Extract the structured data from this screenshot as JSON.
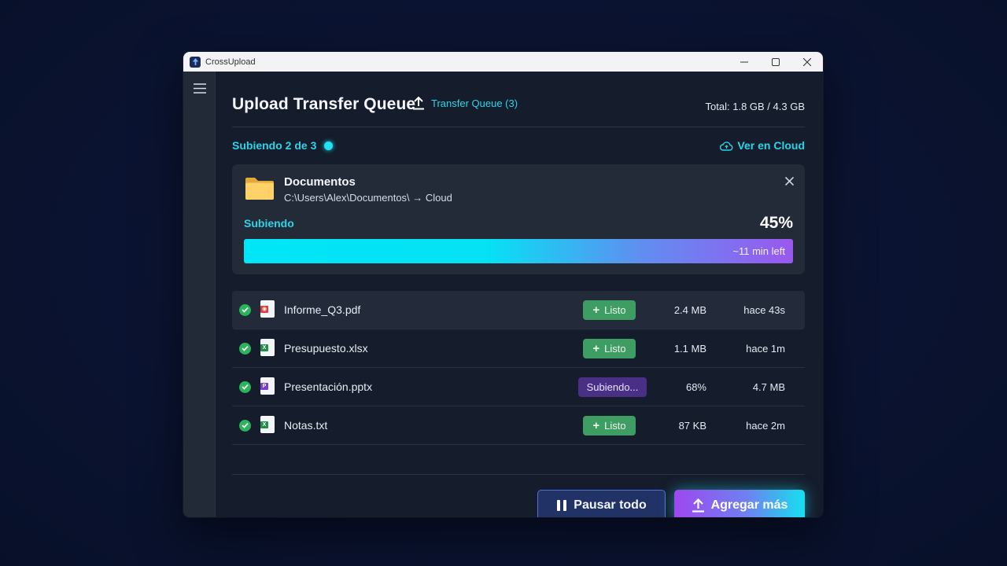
{
  "window": {
    "app_name": "CrossUpload"
  },
  "header": {
    "title": "Upload Transfer Queue",
    "queue_link": "Transfer Queue (3)",
    "total": "Total: 1.8 GB / 4.3 GB"
  },
  "status": {
    "text": "Subiendo 2 de 3",
    "cloud_link": "Ver en Cloud"
  },
  "current": {
    "name": "Documentos",
    "path": "C:\\Users\\Alex\\Documentos\\ → Cloud",
    "state": "Subiendo",
    "percent_label": "45%",
    "progress": 0.45,
    "eta": "~11 min left"
  },
  "files": [
    {
      "name": "Informe_Q3.pdf",
      "type": "pdf",
      "badge": "Listo",
      "badge_kind": "done",
      "col1": "2.4 MB",
      "col2": "hace 43s"
    },
    {
      "name": "Presupuesto.xlsx",
      "type": "xlsx",
      "badge": "Listo",
      "badge_kind": "done",
      "col1": "1.1 MB",
      "col2": "hace 1m"
    },
    {
      "name": "Presentación.pptx",
      "type": "pptx",
      "badge": "Subiendo...",
      "badge_kind": "uploading",
      "col1": "68%",
      "col2": "4.7 MB"
    },
    {
      "name": "Notas.txt",
      "type": "txt",
      "badge": "Listo",
      "badge_kind": "done",
      "col1": "87 KB",
      "col2": "hace 2m"
    }
  ],
  "actions": {
    "pause": "Pausar todo",
    "add": "Agregar más"
  },
  "colors": {
    "accent": "#2ad4e9",
    "success": "#3d9d62",
    "uploading": "#4a2f87",
    "background": "#151c2b"
  },
  "icons": [
    "app-logo-icon",
    "minimize-icon",
    "maximize-icon",
    "close-icon",
    "menu-icon",
    "upload-icon",
    "cloud-icon",
    "folder-icon",
    "check-icon",
    "pdf-file-icon",
    "excel-file-icon",
    "powerpoint-file-icon",
    "text-file-icon",
    "plus-icon",
    "pause-icon"
  ]
}
